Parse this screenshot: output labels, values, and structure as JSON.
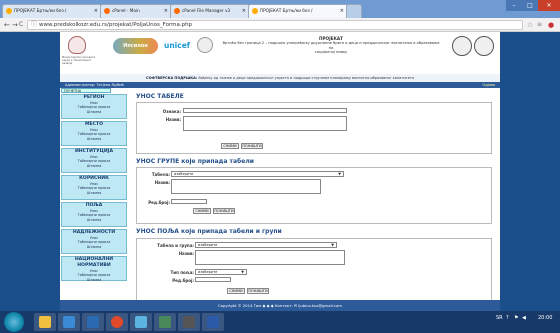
{
  "browser": {
    "tabs": [
      {
        "label": "ПРОЈЕКАТ Бртњ/ки без (",
        "color": "#ffae00"
      },
      {
        "label": "cPanel - Main",
        "color": "#ff6a00"
      },
      {
        "label": "cPanel File Manager v3",
        "color": "#ff6a00"
      },
      {
        "label": "ПРОЈЕКАТ Бртњ/ки без /",
        "color": "#ffae00"
      }
    ],
    "url": "www.predskolkozr.edu.rs/projekat/PoljaUnos_Forma.php",
    "window_controls": [
      "–",
      "□",
      "✕"
    ]
  },
  "header": {
    "crest_caption": "Министарство просвете, науке и технолошког развоја",
    "logo1_text": "Ипсилон",
    "unicef": "unicef",
    "project_title": "ПРОЈЕКАТ",
    "project_sub": "Вртићи без граница 2 – подршка унапређењу друштвене бриге о деци и предшколског васпитања и образовања на",
    "project_sub2": "социјалној нивоу"
  },
  "strip": {
    "bold": "СОФТВЕРСКА ПОДРШКА:",
    "text": " Вођењу од тажње о деци предшколског узраста и подршци стручним планирању васпитно-образовног капатитета"
  },
  "userbar": {
    "user": "Администратор: Татјана Љубић",
    "logout": "Одјава"
  },
  "sidebar": {
    "home": "ПОЧЕТНА",
    "groups": [
      {
        "title": "РЕГИОН",
        "items": [
          "Унос",
          "Табеларни приказ",
          "Штампа"
        ]
      },
      {
        "title": "МЕСТО",
        "items": [
          "Унос",
          "Табеларни приказ",
          "Штампа"
        ]
      },
      {
        "title": "ИНСТИТУЦИЈА",
        "items": [
          "Унос",
          "Табеларни приказ",
          "Штампа"
        ]
      },
      {
        "title": "КОРИСНИК",
        "items": [
          "Унос",
          "Табеларни приказ",
          "Штампа"
        ]
      },
      {
        "title": "ПОЉА",
        "items": [
          "Унос",
          "Табеларни приказ",
          "Штампа"
        ]
      },
      {
        "title": "НАДЛЕЖНОСТИ",
        "items": [
          "Унос",
          "Табеларни приказ",
          "Штампа"
        ]
      },
      {
        "title": "НАЦИОНАЛНИ НОРМАТИВИ",
        "items": [
          "Унос",
          "Табеларни приказ",
          "Штампа"
        ]
      }
    ]
  },
  "forms": {
    "table": {
      "title": "УНОС ТАБЕЛЕ",
      "label_code": "Ознака:",
      "label_name": "Назив:",
      "save": "СНИМИ",
      "reset": "ПОНИШТИ"
    },
    "group": {
      "title": "УНОС ГРУПЕ које припада табели",
      "label_table": "Табела:",
      "table_value": "изаберите",
      "label_name": "Назив:",
      "label_order": "Ред.број:",
      "save": "СНИМИ",
      "reset": "ПОНИШТИ"
    },
    "field": {
      "title": "УНОС ПОЉА које припада табели и групи",
      "label_tg": "Табела и група:",
      "tg_value": "изаберите",
      "label_name": "Назив:",
      "label_type": "Тип поља:",
      "type_value": "изаберите",
      "label_order": "Ред.број:",
      "save": "СНИМИ",
      "reset": "ПОНИШТИ"
    }
  },
  "footer": "Copyright © 2014 Тим ◆ ◆ ◆ Контакт: ✉ ljubica.kuz@gmail.com",
  "taskbar": {
    "apps": [
      {
        "icon": "folder-icon",
        "color": "#f0c040"
      },
      {
        "icon": "calendar-icon",
        "color": "#3a8ad6"
      },
      {
        "icon": "save-disk-icon",
        "color": "#2a6ab0"
      },
      {
        "icon": "chrome-icon",
        "color": "#e04a2a"
      },
      {
        "icon": "notes-icon",
        "color": "#5bb5e0"
      },
      {
        "icon": "shield-icon",
        "color": "#4a8a5a"
      },
      {
        "icon": "window-icon",
        "color": "#555"
      },
      {
        "icon": "word-icon",
        "color": "#2a5aa8"
      }
    ],
    "lang": "SR",
    "time": "20:00"
  }
}
